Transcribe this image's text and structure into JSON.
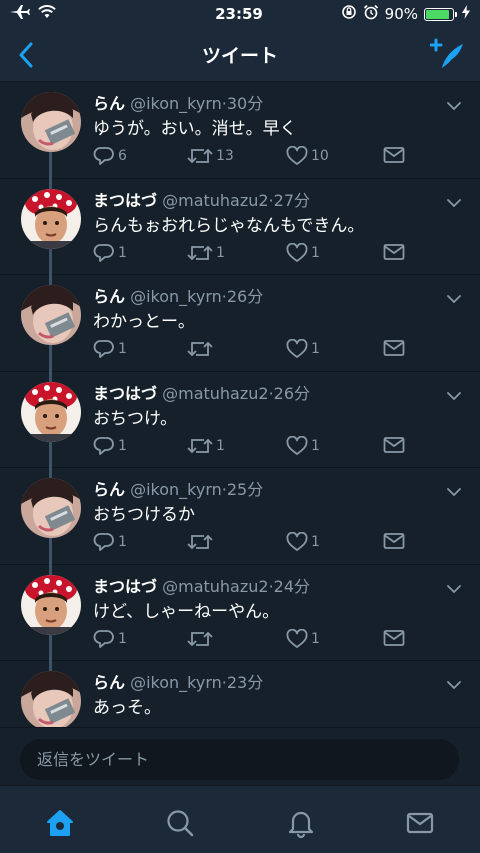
{
  "status_bar": {
    "time": "23:59",
    "battery": "90%",
    "battery_level": 0.9,
    "icons": [
      "airplane-icon",
      "wifi-icon",
      "rotation-lock-icon",
      "alarm-icon",
      "battery-icon",
      "charging-icon"
    ]
  },
  "navbar": {
    "title": "ツイート",
    "back_icon": "chevron-left-icon",
    "compose_icon": "compose-tweet-icon"
  },
  "tweets": [
    {
      "name": "らん",
      "handle": "@ikon_kyrn",
      "time": "30分",
      "text": "ゆうが。おい。消せ。早く",
      "replies": "6",
      "retweets": "13",
      "likes": "10"
    },
    {
      "name": "まつはづ",
      "handle": "@matuhazu2",
      "time": "27分",
      "text": "らんもぉおれらじゃなんもできん。",
      "replies": "1",
      "retweets": "1",
      "likes": "1"
    },
    {
      "name": "らん",
      "handle": "@ikon_kyrn",
      "time": "26分",
      "text": "わかっとー。",
      "replies": "1",
      "retweets": "",
      "likes": "1"
    },
    {
      "name": "まつはづ",
      "handle": "@matuhazu2",
      "time": "26分",
      "text": "おちつけ。",
      "replies": "1",
      "retweets": "1",
      "likes": "1"
    },
    {
      "name": "らん",
      "handle": "@ikon_kyrn",
      "time": "25分",
      "text": "おちつけるか",
      "replies": "1",
      "retweets": "",
      "likes": "1"
    },
    {
      "name": "まつはづ",
      "handle": "@matuhazu2",
      "time": "24分",
      "text": "けど、しゃーねーやん。",
      "replies": "1",
      "retweets": "",
      "likes": "1"
    },
    {
      "name": "らん",
      "handle": "@ikon_kyrn",
      "time": "23分",
      "text": "あっそ。",
      "replies": "",
      "retweets": "",
      "likes": ""
    }
  ],
  "reply": {
    "placeholder": "返信をツイート",
    "value": ""
  },
  "tabs": [
    "home-icon",
    "search-icon",
    "notifications-icon",
    "messages-icon"
  ],
  "colors": {
    "background": "#15202b",
    "bar": "#1c2938",
    "accent": "#1da1f2",
    "muted": "#8899a6",
    "thread_line": "#3d5466"
  }
}
